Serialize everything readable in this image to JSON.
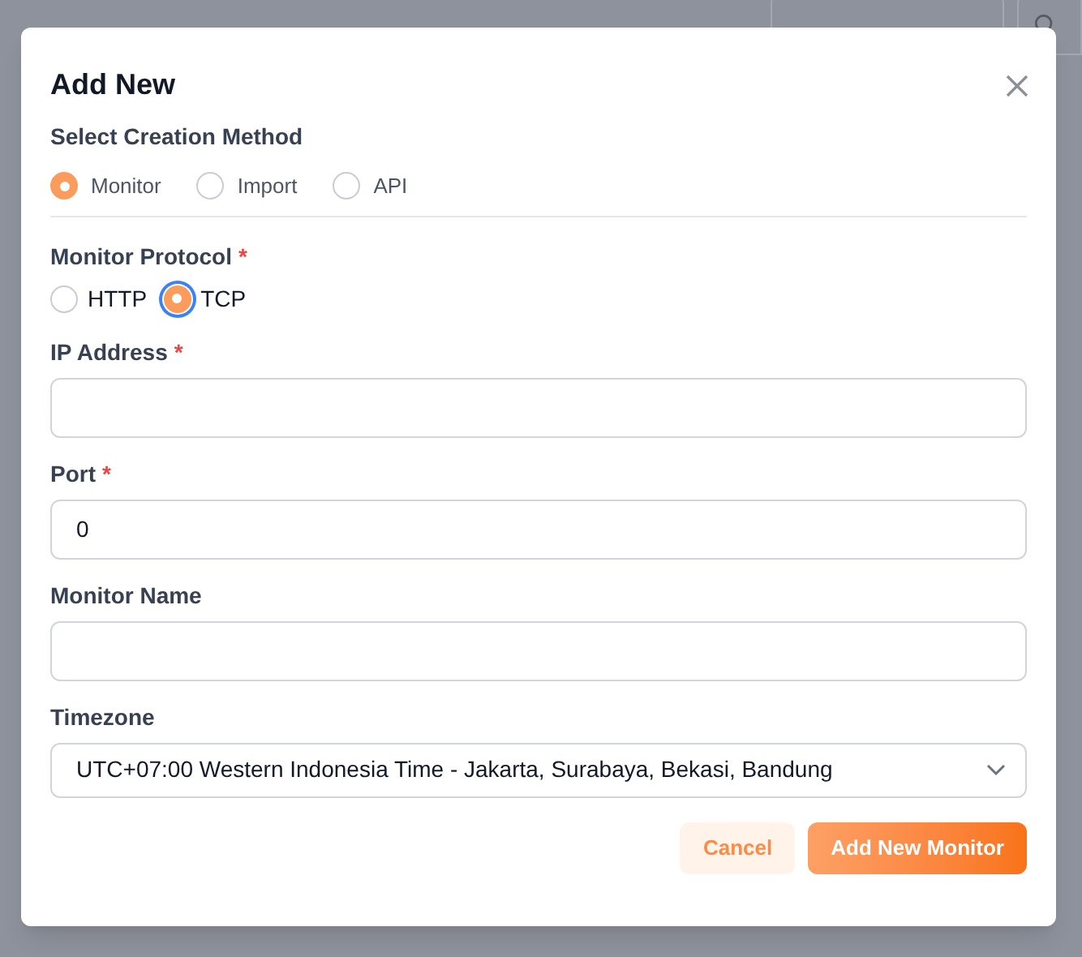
{
  "dialog": {
    "title": "Add New",
    "creation_method": {
      "label": "Select Creation Method",
      "options": [
        {
          "label": "Monitor",
          "selected": true
        },
        {
          "label": "Import",
          "selected": false
        },
        {
          "label": "API",
          "selected": false
        }
      ]
    },
    "protocol": {
      "label": "Monitor Protocol",
      "required_mark": "*",
      "options": [
        {
          "label": "HTTP",
          "selected": false
        },
        {
          "label": "TCP",
          "selected": true
        }
      ]
    },
    "fields": [
      {
        "label": "IP Address",
        "required_mark": "*"
      },
      {
        "label": "Port",
        "required_mark": "*",
        "value": "0"
      },
      {
        "label": "Monitor Name"
      }
    ],
    "timezone": {
      "label": "Timezone",
      "value": "UTC+07:00 Western Indonesia Time - Jakarta, Surabaya, Bekasi, Bandung"
    },
    "buttons": [
      {
        "label": "Cancel",
        "kind": "secondary"
      },
      {
        "label": "Add New Monitor",
        "kind": "primary"
      }
    ]
  }
}
